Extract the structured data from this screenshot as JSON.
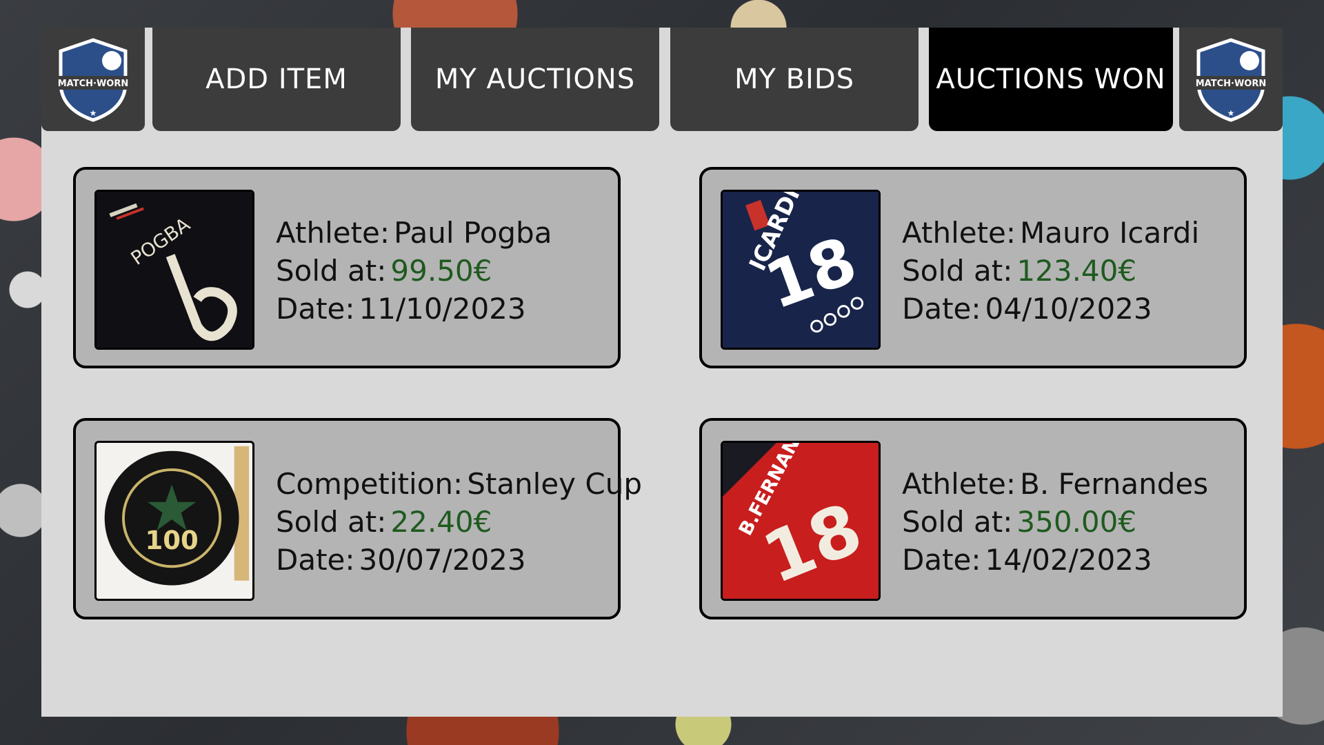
{
  "brand": {
    "logo_text": "MATCH·WORN"
  },
  "nav": {
    "tabs": [
      {
        "label": "ADD ITEM"
      },
      {
        "label": "MY AUCTIONS"
      },
      {
        "label": "MY BIDS"
      },
      {
        "label": "AUCTIONS WON"
      }
    ],
    "active_tab": "AUCTIONS WON"
  },
  "auctions": [
    {
      "label": "Athlete:",
      "name": "Paul Pogba",
      "sold_label": "Sold at:",
      "price": "99.50€",
      "date_label": "Date:",
      "date": "11/10/2023",
      "image": "pogba-jersey"
    },
    {
      "label": "Athlete:",
      "name": "Mauro Icardi",
      "sold_label": "Sold at:",
      "price": "123.40€",
      "date_label": "Date:",
      "date": "04/10/2023",
      "image": "icardi-jersey"
    },
    {
      "label": "Competition:",
      "name": "Stanley Cup",
      "sold_label": "Sold at:",
      "price": "22.40€",
      "date_label": "Date:",
      "date": "30/07/2023",
      "image": "stanley-cup-puck"
    },
    {
      "label": "Athlete:",
      "name": "B. Fernandes",
      "sold_label": "Sold at:",
      "price": "350.00€",
      "date_label": "Date:",
      "date": "14/02/2023",
      "image": "fernandes-jersey"
    }
  ],
  "colors": {
    "nav_bg": "#3c3c3c",
    "nav_active": "#000000",
    "price": "#1f5a1f",
    "card_bg": "#b4b4b4"
  }
}
